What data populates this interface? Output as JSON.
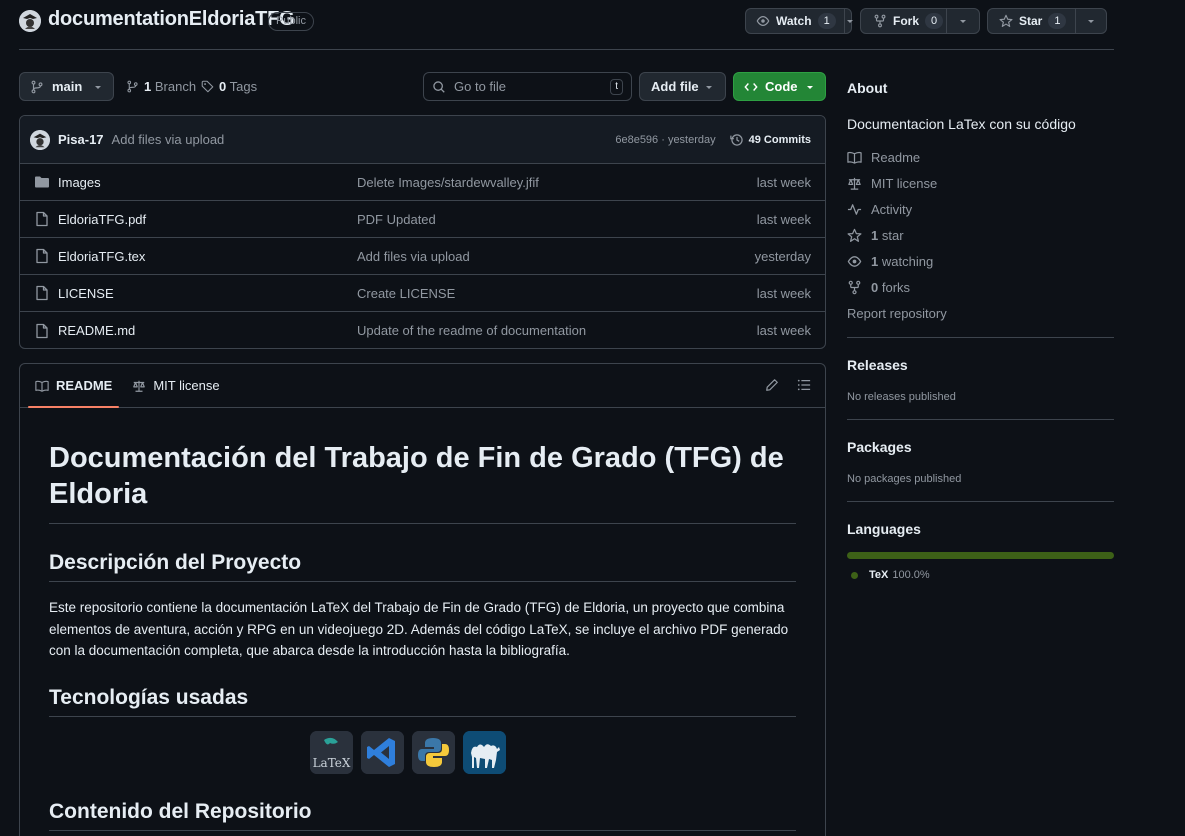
{
  "repo": {
    "name": "documentationEldoriaTFG",
    "visibility": "Public"
  },
  "header_actions": {
    "watch": {
      "label": "Watch",
      "count": "1"
    },
    "fork": {
      "label": "Fork",
      "count": "0"
    },
    "star": {
      "label": "Star",
      "count": "1"
    }
  },
  "branch_bar": {
    "branch": "main",
    "branches_count": "1",
    "branches_label": "Branch",
    "tags_count": "0",
    "tags_label": "Tags",
    "goto_placeholder": "Go to file",
    "goto_shortcut": "t",
    "add_file_label": "Add file",
    "code_label": "Code"
  },
  "latest_commit": {
    "author": "Pisa-17",
    "message": "Add files via upload",
    "hash_time": "6e8e596 · yesterday",
    "commits_label": "49 Commits"
  },
  "files": [
    {
      "name": "Images",
      "type": "folder",
      "commit": "Delete Images/stardewvalley.jfif",
      "date": "last week"
    },
    {
      "name": "EldoriaTFG.pdf",
      "type": "file",
      "commit": "PDF Updated",
      "date": "last week"
    },
    {
      "name": "EldoriaTFG.tex",
      "type": "file",
      "commit": "Add files via upload",
      "date": "yesterday"
    },
    {
      "name": "LICENSE",
      "type": "file",
      "commit": "Create LICENSE",
      "date": "last week"
    },
    {
      "name": "README.md",
      "type": "file",
      "commit": "Update of the readme of documentation",
      "date": "last week"
    }
  ],
  "readme_tabs": {
    "readme": "README",
    "license": "MIT license"
  },
  "readme": {
    "title": "Documentación del Trabajo de Fin de Grado (TFG) de Eldoria",
    "section1_heading": "Descripción del Proyecto",
    "section1_text": "Este repositorio contiene la documentación LaTeX del Trabajo de Fin de Grado (TFG) de Eldoria, un proyecto que combina elementos de aventura, acción y RPG en un videojuego 2D. Además del código LaTeX, se incluye el archivo PDF generado con la documentación completa, que abarca desde la introducción hasta la bibliografía.",
    "section2_heading": "Tecnologías usadas",
    "tech_icons": [
      "latex-icon",
      "vscode-icon",
      "python-icon",
      "perl-camel-icon"
    ],
    "latex_logo_text": "LaTeX",
    "section3_heading": "Contenido del Repositorio"
  },
  "sidebar": {
    "about_heading": "About",
    "description": "Documentacion LaTex con su código",
    "readme_link": "Readme",
    "license_link": "MIT license",
    "activity_link": "Activity",
    "stars_count": "1",
    "stars_label": "star",
    "watching_count": "1",
    "watching_label": "watching",
    "forks_count": "0",
    "forks_label": "forks",
    "report_link": "Report repository",
    "releases_heading": "Releases",
    "releases_empty": "No releases published",
    "packages_heading": "Packages",
    "packages_empty": "No packages published",
    "languages_heading": "Languages",
    "language_name": "TeX",
    "language_percent": "100.0%",
    "language_color": "#3D6117"
  },
  "colors": {
    "background": "#0d1117",
    "border": "#3d444d",
    "accent_green": "#238636",
    "tab_underline": "#f78166",
    "muted_text": "#9198a1"
  }
}
